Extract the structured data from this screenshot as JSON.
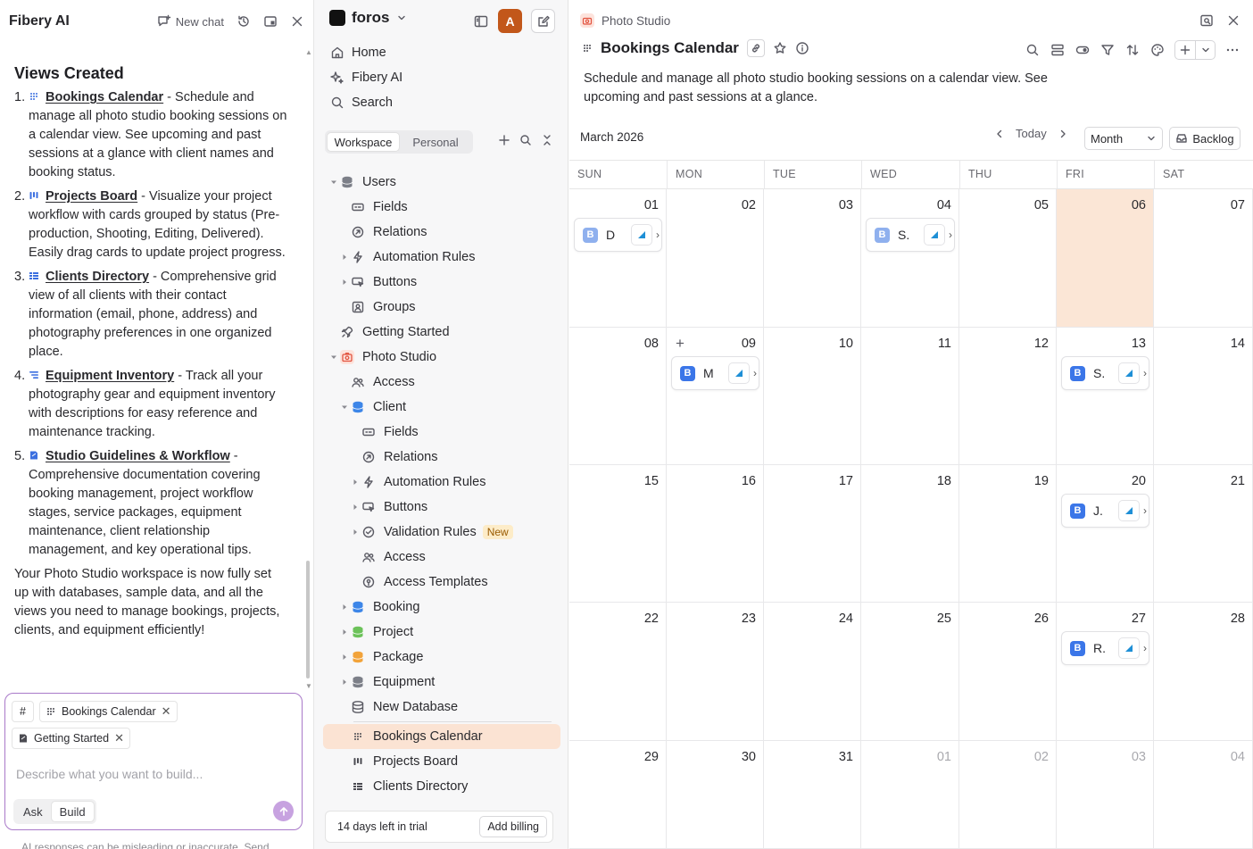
{
  "ai_panel": {
    "title": "Fibery AI",
    "new_chat_label": "New chat",
    "heading": "Views Created",
    "items": [
      {
        "num": "1.",
        "icon": "calendar-view-icon",
        "link": "Bookings Calendar",
        "text": " - Schedule and manage all photo studio booking sessions on a calendar view. See upcoming and past sessions at a glance with client names and booking status."
      },
      {
        "num": "2.",
        "icon": "board-view-icon",
        "link": "Projects Board",
        "text": " - Visualize your project workflow with cards grouped by status (Pre-production, Shooting, Editing, Delivered). Easily drag cards to update project progress."
      },
      {
        "num": "3.",
        "icon": "grid-view-icon",
        "link": "Clients Directory",
        "text": " - Comprehensive grid view of all clients with their contact information (email, phone, address) and photography preferences in one organized place."
      },
      {
        "num": "4.",
        "icon": "list-view-icon",
        "link": "Equipment Inventory",
        "text": " - Track all your photography gear and equipment inventory with descriptions for easy reference and maintenance tracking."
      },
      {
        "num": "5.",
        "icon": "document-view-icon",
        "link": "Studio Guidelines & Workflow",
        "text": " - Comprehensive documentation covering booking management, project workflow stages, service packages, equipment maintenance, client relationship management, and key operational tips."
      }
    ],
    "summary": "Your Photo Studio workspace is now fully set up with databases, sample data, and all the views you need to manage bookings, projects, clients, and equipment efficiently!",
    "composer": {
      "hash": "#",
      "chips": [
        "Bookings Calendar",
        "Getting Started"
      ],
      "placeholder": "Describe what you want to build...",
      "mode_ask": "Ask",
      "mode_build": "Build"
    },
    "disclaimer": "AI responses can be misleading or inaccurate. Send"
  },
  "sidebar": {
    "workspace": "foros",
    "avatar_letter": "A",
    "nav": [
      {
        "label": "Home",
        "icon": "home-icon"
      },
      {
        "label": "Fibery AI",
        "icon": "sparkle-icon"
      },
      {
        "label": "Search",
        "icon": "search-icon"
      }
    ],
    "tabs": [
      "Workspace",
      "Personal"
    ],
    "tree": [
      {
        "label": "Users",
        "level": 0,
        "caret": "down",
        "icon": "database-gray"
      },
      {
        "label": "Fields",
        "level": 1,
        "caret": "",
        "icon": "fields-icon"
      },
      {
        "label": "Relations",
        "level": 1,
        "caret": "",
        "icon": "relations-icon"
      },
      {
        "label": "Automation Rules",
        "level": 1,
        "caret": "right",
        "icon": "bolt-icon"
      },
      {
        "label": "Buttons",
        "level": 1,
        "caret": "right",
        "icon": "button-icon"
      },
      {
        "label": "Groups",
        "level": 1,
        "caret": "",
        "icon": "groups-icon"
      },
      {
        "label": "Getting Started",
        "level": 0,
        "caret": "",
        "icon": "rocket-icon"
      },
      {
        "label": "Photo Studio",
        "level": 0,
        "caret": "down",
        "icon": "camera-icon"
      },
      {
        "label": "Access",
        "level": 1,
        "caret": "",
        "icon": "people-icon"
      },
      {
        "label": "Client",
        "level": 1,
        "caret": "down",
        "icon": "database-blue"
      },
      {
        "label": "Fields",
        "level": 2,
        "caret": "",
        "icon": "fields-icon"
      },
      {
        "label": "Relations",
        "level": 2,
        "caret": "",
        "icon": "relations-icon"
      },
      {
        "label": "Automation Rules",
        "level": 2,
        "caret": "right",
        "icon": "bolt-icon"
      },
      {
        "label": "Buttons",
        "level": 2,
        "caret": "right",
        "icon": "button-icon"
      },
      {
        "label": "Validation Rules",
        "level": 2,
        "caret": "right",
        "icon": "check-circle-icon",
        "badge": "New"
      },
      {
        "label": "Access",
        "level": 2,
        "caret": "",
        "icon": "people-icon"
      },
      {
        "label": "Access Templates",
        "level": 2,
        "caret": "",
        "icon": "pin-icon"
      },
      {
        "label": "Booking",
        "level": 1,
        "caret": "right",
        "icon": "database-blue"
      },
      {
        "label": "Project",
        "level": 1,
        "caret": "right",
        "icon": "database-green"
      },
      {
        "label": "Package",
        "level": 1,
        "caret": "right",
        "icon": "database-orange"
      },
      {
        "label": "Equipment",
        "level": 1,
        "caret": "right",
        "icon": "database-gray"
      },
      {
        "label": "New Database",
        "level": 1,
        "caret": "",
        "icon": "database-outline"
      },
      {
        "label": "Bookings Calendar",
        "level": 1,
        "caret": "",
        "icon": "calendar-view-icon",
        "selected": true,
        "sep_before": true
      },
      {
        "label": "Projects Board",
        "level": 1,
        "caret": "",
        "icon": "board-view-icon"
      },
      {
        "label": "Clients Directory",
        "level": 1,
        "caret": "",
        "icon": "grid-view-icon"
      }
    ],
    "trial_days": "14 days",
    "trial_rest": " left in trial",
    "trial_button": "Add billing"
  },
  "main": {
    "breadcrumb": "Photo Studio",
    "view_title": "Bookings Calendar",
    "description": "Schedule and manage all photo studio booking sessions on a calendar view. See upcoming and past sessions at a glance.",
    "month_label": "March 2026",
    "today_label": "Today",
    "range_select": "Month",
    "backlog_label": "Backlog",
    "weekdays": [
      "SUN",
      "MON",
      "TUE",
      "WED",
      "THU",
      "FRI",
      "SAT"
    ],
    "weeks": [
      [
        "01",
        "02",
        "03",
        "04",
        "05",
        "06",
        "07"
      ],
      [
        "08",
        "09",
        "10",
        "11",
        "12",
        "13",
        "14"
      ],
      [
        "15",
        "16",
        "17",
        "18",
        "19",
        "20",
        "21"
      ],
      [
        "22",
        "23",
        "24",
        "25",
        "26",
        "27",
        "28"
      ],
      [
        "29",
        "30",
        "31",
        "01",
        "02",
        "03",
        "04"
      ]
    ],
    "today_day": "06",
    "events": [
      {
        "week": 0,
        "day": 0,
        "badge": "B",
        "text": "D",
        "light": true
      },
      {
        "week": 0,
        "day": 3,
        "badge": "B",
        "text": "S.",
        "light": true
      },
      {
        "week": 1,
        "day": 1,
        "badge": "B",
        "text": "M",
        "light": false
      },
      {
        "week": 1,
        "day": 5,
        "badge": "B",
        "text": "S.",
        "light": false
      },
      {
        "week": 2,
        "day": 5,
        "badge": "B",
        "text": "J.",
        "light": false
      },
      {
        "week": 3,
        "day": 5,
        "badge": "B",
        "text": "R.",
        "light": false
      }
    ],
    "colors": {
      "accent": "#c2571a",
      "today_bg": "#fbe6d6",
      "badge_blue": "#3b76e8",
      "tag_blue": "#1e8fd6"
    }
  }
}
